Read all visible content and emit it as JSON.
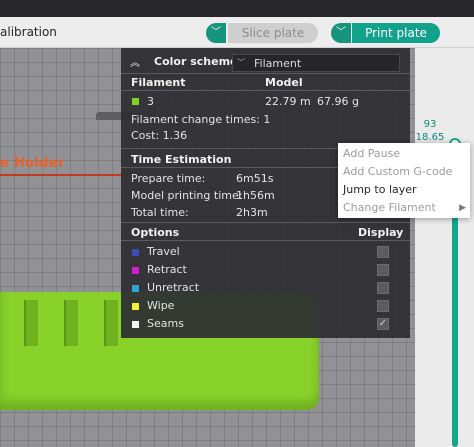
{
  "toolbar": {
    "title": "alibration",
    "slice_label": "Slice plate",
    "print_label": "Print plate",
    "dropdown_glyph": "﹀"
  },
  "viewport": {
    "plate_label": "e Holder"
  },
  "legend": {
    "collapse_glyph": "︽",
    "scheme_label": "Color scheme",
    "scheme_chevron": "﹀",
    "scheme_value": "Filament",
    "filament_header": "Filament",
    "model_header": "Model",
    "filament_name": "3",
    "filament_length": "22.79 m",
    "filament_weight": "67.96 g",
    "filament_color": "#7fd325",
    "filament_changes": "Filament change times:  1",
    "cost": "Cost:  1.36",
    "time_header": "Time Estimation",
    "times": [
      {
        "label": "Prepare time:",
        "value": "6m51s"
      },
      {
        "label": "Model printing time:",
        "value": "1h56m"
      },
      {
        "label": "Total time:",
        "value": "2h3m"
      }
    ],
    "options_header": "Options",
    "display_header": "Display",
    "options": [
      {
        "label": "Travel",
        "color": "#3e4bb8",
        "checked": false
      },
      {
        "label": "Retract",
        "color": "#d21ed2",
        "checked": false
      },
      {
        "label": "Unretract",
        "color": "#2aa7d8",
        "checked": false
      },
      {
        "label": "Wipe",
        "color": "#f4f032",
        "checked": false
      },
      {
        "label": "Seams",
        "color": "#f2f2f2",
        "checked": true
      }
    ],
    "check_glyph": "✓"
  },
  "slider": {
    "layer": "93",
    "height": "18.65"
  },
  "context_menu": {
    "items": [
      "Add Pause",
      "Add Custom G-code",
      "Jump to layer",
      "Change Filament"
    ],
    "arrow_glyph": "▶"
  },
  "colors": {
    "accent": "#17947e",
    "model": "#88d22a"
  }
}
